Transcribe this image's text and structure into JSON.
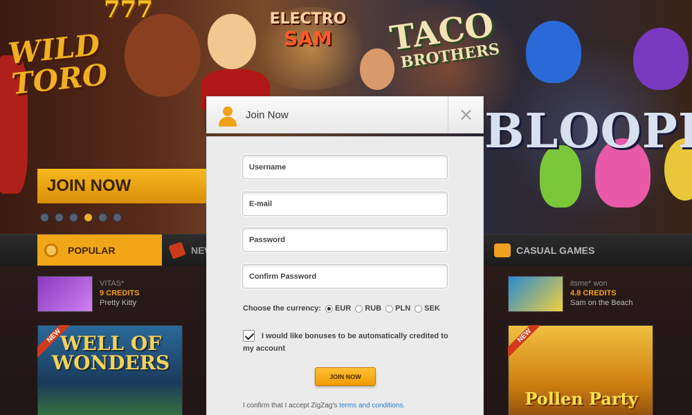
{
  "hero": {
    "logo_text": "777",
    "games": {
      "wild_toro": "WILD TORO",
      "electro_sam_top": "ELECTRO",
      "electro_sam_bottom": "SAM",
      "taco_top": "TACO",
      "taco_bottom": "BROTHERS",
      "blooper": "BLOOPER"
    },
    "join_button": "JOIN NOW",
    "slide_count": 6,
    "active_slide": 4
  },
  "nav": {
    "tabs": [
      {
        "label": "POPULAR",
        "icon": "chip-icon",
        "active": true
      },
      {
        "label": "NEW",
        "icon": "new-tag-icon",
        "active": false
      },
      {
        "label": "CASUAL GAMES",
        "icon": "dice-icon",
        "active": false
      }
    ]
  },
  "winners": [
    {
      "name": "VITAS*",
      "amount": "9 CREDITS",
      "game": "Pretty Kitty",
      "thumb": "pretty-kitty-thumbnail"
    },
    {
      "name": "itsme* won",
      "amount": "4.8 CREDITS",
      "game": "Sam on the Beach",
      "thumb": "sam-on-the-beach-thumbnail"
    }
  ],
  "game_cards": [
    {
      "title": "WELL OF WONDERS",
      "badge": "NEW"
    },
    {
      "title": "Pollen Party",
      "badge": "NEW"
    }
  ],
  "modal": {
    "title": "Join Now",
    "close_label": "×",
    "fields": {
      "username": {
        "placeholder": "Username",
        "value": ""
      },
      "email": {
        "placeholder": "E-mail",
        "value": ""
      },
      "password": {
        "placeholder": "Password",
        "value": ""
      },
      "confirm_password": {
        "placeholder": "Confirm Password",
        "value": ""
      }
    },
    "currency": {
      "label": "Choose the currency:",
      "options": [
        "EUR",
        "RUB",
        "PLN",
        "SEK"
      ],
      "selected": "EUR"
    },
    "bonus_checkbox": {
      "label": "I would like bonuses to be automatically credited to my account",
      "checked": true
    },
    "submit_label": "JOIN NOW",
    "terms": {
      "prefix": "I confirm that I accept ZigZag's",
      "link": "terms and conditions",
      "suffix": "."
    }
  },
  "colors": {
    "accent": "#f2a118",
    "link": "#2a7ad0",
    "winner_amount": "#f0a020"
  }
}
